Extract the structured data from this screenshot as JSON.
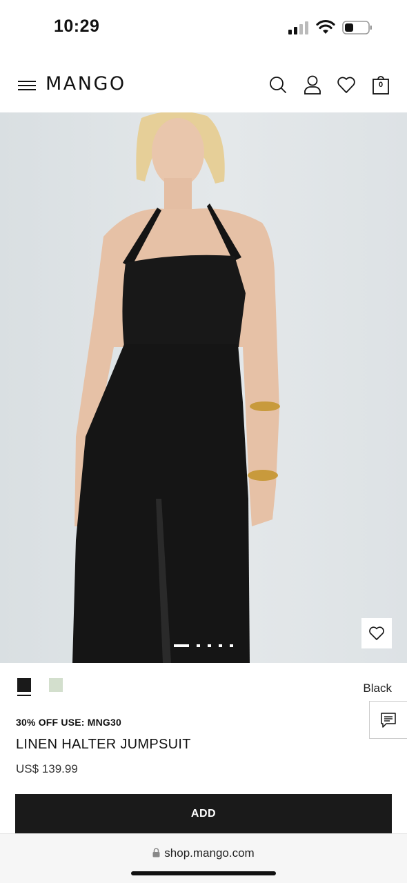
{
  "status_bar": {
    "time": "10:29"
  },
  "header": {
    "logo": "MANGO",
    "bag_count": "0"
  },
  "product": {
    "promo": "30% OFF USE: MNG30",
    "name": "LINEN HALTER JUMPSUIT",
    "price": "US$ 139.99",
    "selected_color": "Black",
    "colors": [
      {
        "name": "black",
        "hex": "#1a1a1a"
      },
      {
        "name": "sage",
        "hex": "#d3dfcd"
      }
    ],
    "image_count": 5,
    "current_image": 1
  },
  "actions": {
    "add_label": "ADD"
  },
  "browser": {
    "url": "shop.mango.com"
  },
  "icons": [
    "menu-icon",
    "search-icon",
    "account-icon",
    "wishlist-icon",
    "bag-icon",
    "heart-icon",
    "chat-icon",
    "lock-icon"
  ]
}
